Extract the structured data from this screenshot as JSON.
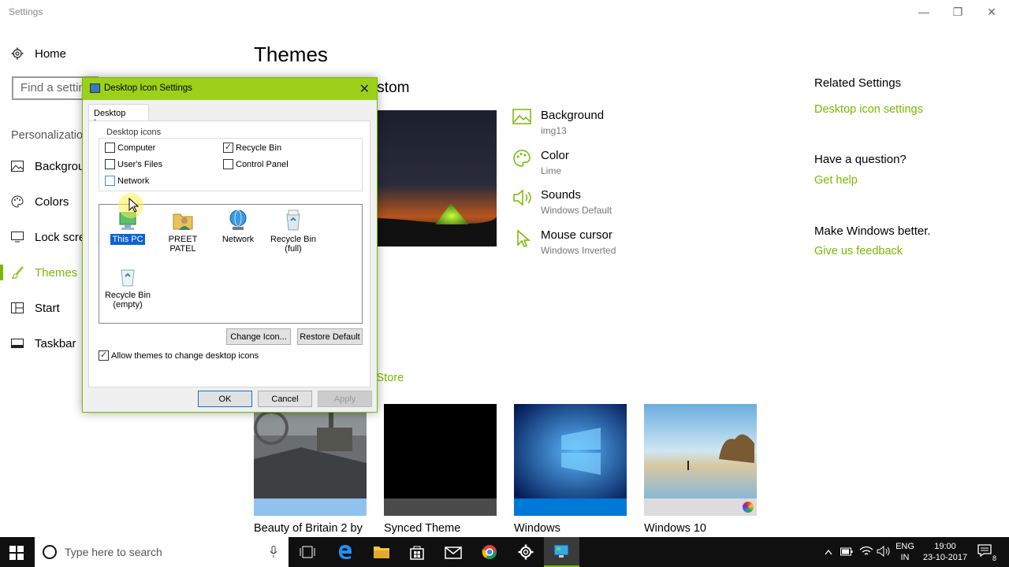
{
  "window": {
    "title": "Settings"
  },
  "sidebar": {
    "home_label": "Home",
    "search_placeholder": "Find a setting",
    "section_label": "Personalization",
    "items": [
      {
        "label": "Background",
        "icon": "image-icon"
      },
      {
        "label": "Colors",
        "icon": "palette-icon"
      },
      {
        "label": "Lock screen",
        "icon": "monitor-icon"
      },
      {
        "label": "Themes",
        "icon": "brush-icon"
      },
      {
        "label": "Start",
        "icon": "start-grid-icon"
      },
      {
        "label": "Taskbar",
        "icon": "taskbar-icon"
      }
    ]
  },
  "main": {
    "title": "Themes",
    "current_theme_heading": "Current theme: Custom",
    "settings": [
      {
        "title": "Background",
        "sub": "img13",
        "icon": "image-icon"
      },
      {
        "title": "Color",
        "sub": "Lime",
        "icon": "palette-icon"
      },
      {
        "title": "Sounds",
        "sub": "Windows Default",
        "icon": "speaker-icon"
      },
      {
        "title": "Mouse cursor",
        "sub": "Windows Inverted",
        "icon": "cursor-icon"
      }
    ],
    "store_link": "Get more themes in the Store",
    "themes": [
      {
        "caption": "Beauty of Britain 2 by",
        "strip": "#8fc3ee"
      },
      {
        "caption": "Synced Theme",
        "strip": "#4b4b4b"
      },
      {
        "caption": "Windows",
        "strip": "#0078d7"
      },
      {
        "caption": "Windows 10",
        "strip": "#dcdcdc"
      }
    ]
  },
  "related": {
    "heading": "Related Settings",
    "link": "Desktop icon settings",
    "question_heading": "Have a question?",
    "help_link": "Get help",
    "better_heading": "Make Windows better.",
    "feedback_link": "Give us feedback"
  },
  "dialog": {
    "title": "Desktop Icon Settings",
    "tab": "Desktop Icons",
    "group_label": "Desktop icons",
    "checkboxes": [
      {
        "label": "Computer",
        "checked": false
      },
      {
        "label": "Recycle Bin",
        "checked": true
      },
      {
        "label": "User's Files",
        "checked": false
      },
      {
        "label": "Control Panel",
        "checked": false
      },
      {
        "label": "Network",
        "checked": false
      }
    ],
    "icons": [
      {
        "label": "This PC",
        "selected": true
      },
      {
        "label": "PREET PATEL",
        "selected": false
      },
      {
        "label": "Network",
        "selected": false
      },
      {
        "label": "Recycle Bin (full)",
        "selected": false
      },
      {
        "label": "Recycle Bin (empty)",
        "selected": false
      }
    ],
    "change_icon": "Change Icon...",
    "restore_default": "Restore Default",
    "allow_themes": "Allow themes to change desktop icons",
    "allow_themes_checked": true,
    "ok": "OK",
    "cancel": "Cancel",
    "apply": "Apply"
  },
  "taskbar": {
    "search_placeholder": "Type here to search",
    "language": "ENG",
    "region": "IN",
    "time": "19:00",
    "date": "23-10-2017",
    "notification_count": "8"
  },
  "colors": {
    "accent": "#79b800",
    "dialog_title": "#9cd01a"
  }
}
